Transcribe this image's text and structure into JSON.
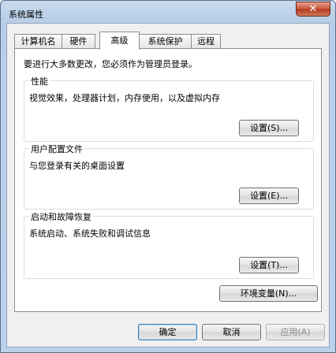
{
  "window": {
    "title": "系统属性",
    "close_glyph": "✕"
  },
  "tabs": [
    {
      "label": "计算机名"
    },
    {
      "label": "硬件"
    },
    {
      "label": "高级",
      "active": true
    },
    {
      "label": "系统保护"
    },
    {
      "label": "远程"
    }
  ],
  "notice": "要进行大多数更改，您必须作为管理员登录。",
  "groups": {
    "performance": {
      "title": "性能",
      "desc": "视觉效果，处理器计划，内存使用，以及虚拟内存",
      "button": "设置(S)..."
    },
    "profiles": {
      "title": "用户配置文件",
      "desc": "与您登录有关的桌面设置",
      "button": "设置(E)..."
    },
    "startup": {
      "title": "启动和故障恢复",
      "desc": "系统启动、系统失败和调试信息",
      "button": "设置(T)..."
    }
  },
  "env_button": "环境变量(N)...",
  "footer": {
    "ok": "确定",
    "cancel": "取消",
    "apply": "应用(A)"
  }
}
